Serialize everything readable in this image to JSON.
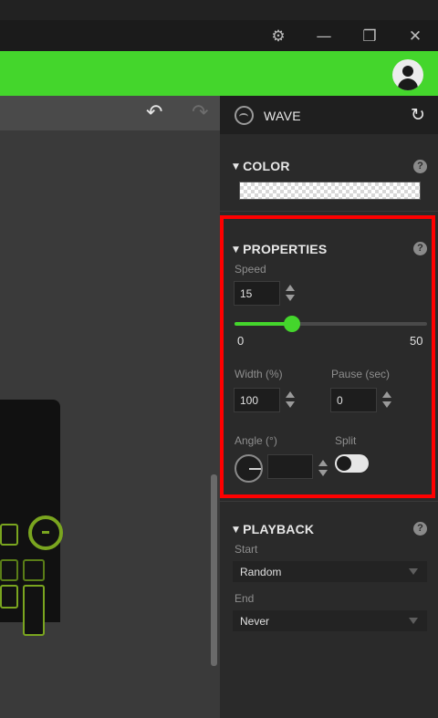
{
  "window": {
    "settings_icon": "gear-icon",
    "minimize_symbol": "—",
    "restore_symbol": "❐",
    "close_symbol": "✕"
  },
  "header": {
    "accent_color": "#44d62c",
    "avatar_icon": "user-avatar-icon"
  },
  "canvas": {
    "undo_symbol": "↶",
    "redo_symbol": "↷"
  },
  "effect": {
    "name": "WAVE",
    "reset_symbol": "↻"
  },
  "color_section": {
    "title": "COLOR",
    "help": "?"
  },
  "properties": {
    "title": "PROPERTIES",
    "help": "?",
    "speed_label": "Speed",
    "speed_value": "15",
    "speed_min": "0",
    "speed_max": "50",
    "speed_fraction": 0.3,
    "width_label": "Width (%)",
    "width_value": "100",
    "pause_label": "Pause (sec)",
    "pause_value": "0",
    "angle_label": "Angle (°)",
    "angle_value": "",
    "split_label": "Split",
    "split_on": false
  },
  "playback": {
    "title": "PLAYBACK",
    "help": "?",
    "start_label": "Start",
    "start_value": "Random",
    "end_label": "End",
    "end_value": "Never"
  }
}
